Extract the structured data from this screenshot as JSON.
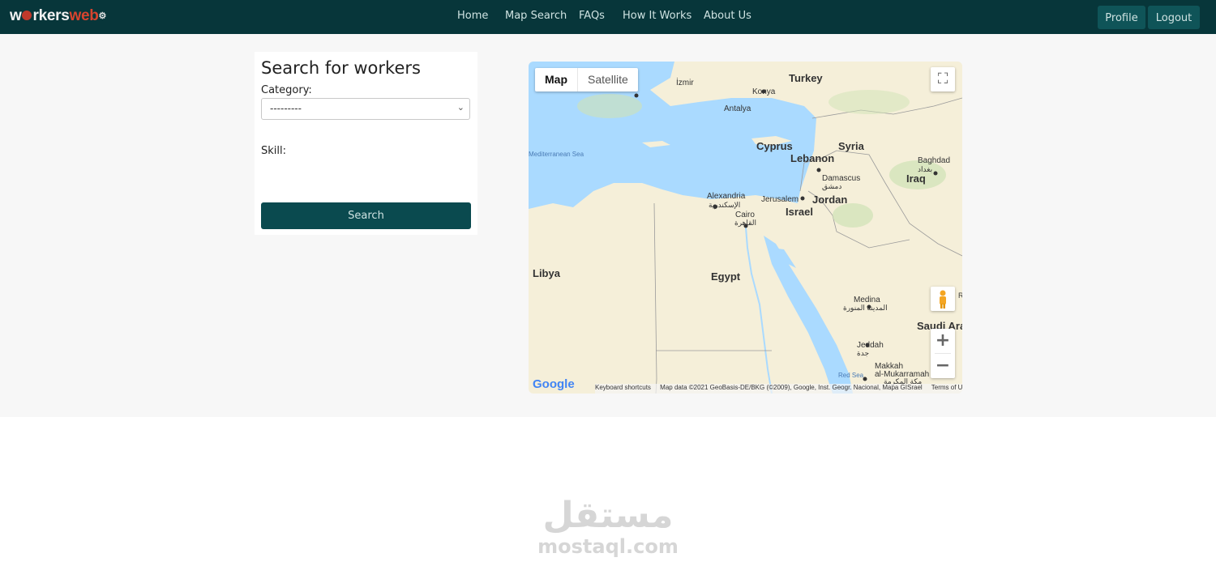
{
  "brand": {
    "prefix": "w",
    "middle": "rkers",
    "suffix": "web"
  },
  "nav": {
    "links": [
      "Home",
      "Map Search",
      "FAQs",
      "How It Works",
      "About Us"
    ],
    "profile": "Profile",
    "logout": "Logout"
  },
  "search": {
    "title": "Search for workers",
    "category_label": "Category:",
    "category_value": "---------",
    "skill_label": "Skill:",
    "button": "Search"
  },
  "map": {
    "type_map": "Map",
    "type_satellite": "Satellite",
    "labels": {
      "turkey": "Turkey",
      "izmir": "İzmir",
      "konya": "Konya",
      "antalya": "Antalya",
      "cyprus": "Cyprus",
      "syria": "Syria",
      "lebanon": "Lebanon",
      "baghdad": "Baghdad",
      "baghdad_ar": "بغداد",
      "iraq": "Iraq",
      "damascus": "Damascus",
      "damascus_ar": "دمشق",
      "jordan": "Jordan",
      "jerusalem": "Jerusalem",
      "israel": "Israel",
      "alexandria": "Alexandria",
      "alexandria_ar": "الإسكندرية",
      "cairo": "Cairo",
      "cairo_ar": "القاهرة",
      "med_sea": "Mediterranean Sea",
      "libya": "Libya",
      "egypt": "Egypt",
      "medina": "Medina",
      "medina_ar": "المدينة المنورة",
      "saudi": "Saudi Ara",
      "jeddah": "Jeddah",
      "jeddah_ar": "جدة",
      "makkah": "Makkah",
      "makkah2": "al-Mukarramah",
      "makkah_ar": "مكة المكرمة",
      "red_sea": "Red Sea",
      "r_edge": "R"
    },
    "google": "Google",
    "shortcuts": "Keyboard shortcuts",
    "attribution": "Map data ©2021 GeoBasis-DE/BKG (©2009), Google, Inst. Geogr. Nacional, Mapa GISrael",
    "terms": "Terms of Use"
  },
  "watermark": {
    "arabic": "مستقل",
    "latin": "mostaql.com"
  },
  "colors": {
    "navbar": "#07363a",
    "button": "#0a4a4f",
    "water": "#aadaff",
    "land": "#f5efd9"
  }
}
